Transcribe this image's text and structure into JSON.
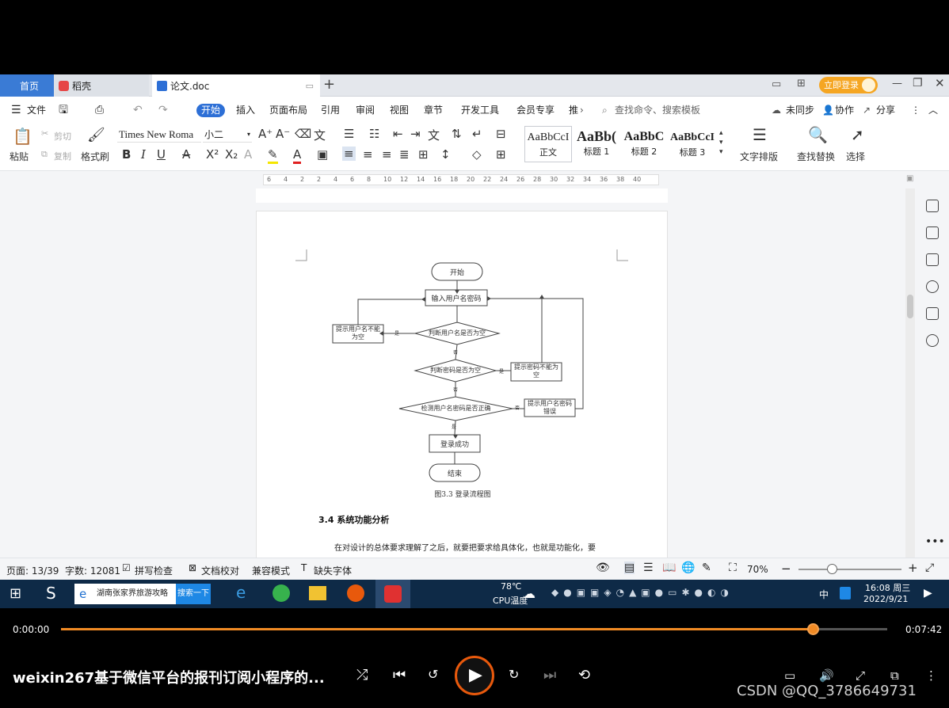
{
  "tabs": {
    "home": "首页",
    "daoke": "稻壳",
    "doc": "论文.doc",
    "login": "立即登录"
  },
  "menu": {
    "file": "文件",
    "items": [
      "开始",
      "插入",
      "页面布局",
      "引用",
      "审阅",
      "视图",
      "章节",
      "开发工具",
      "会员专享",
      "推"
    ],
    "search_placeholder": "查找命令、搜索模板",
    "sync": "未同步",
    "collab": "协作",
    "share": "分享"
  },
  "ribbon": {
    "paste": "粘贴",
    "cut": "剪切",
    "copy": "复制",
    "format_painter": "格式刷",
    "font": "Times New Roma",
    "size": "小二",
    "styles": [
      {
        "preview": "AaBbCcI",
        "label": "正文"
      },
      {
        "preview": "AaBb(",
        "label": "标题 1"
      },
      {
        "preview": "AaBbC",
        "label": "标题 2"
      },
      {
        "preview": "AaBbCcI",
        "label": "标题 3"
      }
    ],
    "text_layout": "文字排版",
    "find_replace": "查找替换",
    "select": "选择"
  },
  "ruler": {
    "ticks": [
      "6",
      "4",
      "2",
      "2",
      "4",
      "6",
      "8",
      "10",
      "12",
      "14",
      "16",
      "18",
      "20",
      "22",
      "24",
      "26",
      "28",
      "30",
      "32",
      "34",
      "36",
      "38",
      "40"
    ]
  },
  "flow": {
    "start": "开始",
    "input": "输入用户名密码",
    "check_user": "判断用户名是否为空",
    "empty_user": "提示用户名不能为空",
    "check_pwd": "判断密码是否为空",
    "empty_pwd": "提示密码不能为空",
    "verify": "检测用户名密码是否正确",
    "wrong": "提示用户名密码错误",
    "success": "登录成功",
    "end": "结束",
    "yes": "是",
    "no": "否",
    "caption": "图3.3 登录流程图"
  },
  "doc": {
    "heading": "3.4 系统功能分析",
    "para": "在对设计的总体要求理解了之后，就要把要求给具体化，也就是功能化，要"
  },
  "status": {
    "page": "页面: 13/39",
    "words": "字数: 12081",
    "spell": "拼写检查",
    "proof": "文档校对",
    "compat": "兼容模式",
    "missing_font": "缺失字体",
    "zoom": "70%"
  },
  "taskbar": {
    "search_text": "湖南张家界旅游攻略",
    "search_btn": "搜索一下",
    "temp": "78℃",
    "cpu": "CPU温度",
    "ime": "中",
    "time": "16:08 周三",
    "date": "2022/9/21"
  },
  "player": {
    "current": "0:00:00",
    "total": "0:07:42",
    "progress": 0.91,
    "title": "weixin267基于微信平台的报刊订阅小程序的...",
    "watermark": "CSDN @QQ_3786649731"
  }
}
